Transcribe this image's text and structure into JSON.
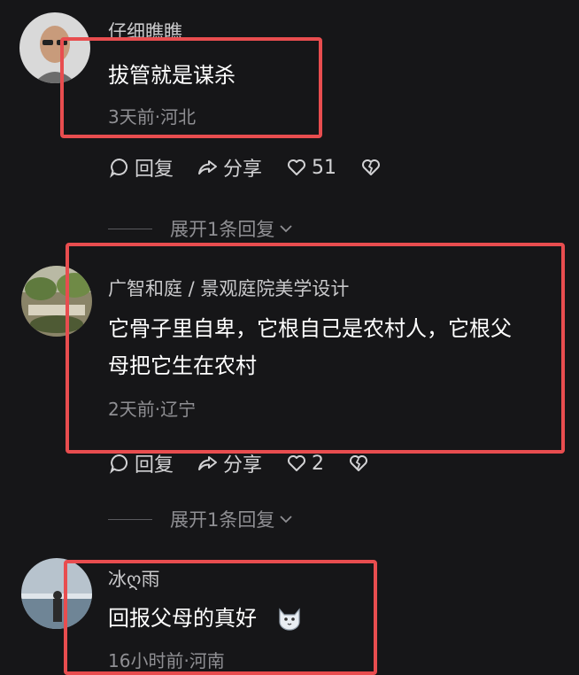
{
  "comments": [
    {
      "username": "仔细瞧瞧",
      "text": "拔管就是谋杀",
      "meta": "3天前·河北",
      "reply_label": "回复",
      "share_label": "分享",
      "likes": "51"
    },
    {
      "username": "广智和庭 / 景观庭院美学设计",
      "text_line1": "它骨子里自卑，它根自己是农村人，它根父",
      "text_line2": "母把它生在农村",
      "meta": "2天前·辽宁",
      "reply_label": "回复",
      "share_label": "分享",
      "likes": "2"
    },
    {
      "username": "冰ღ雨",
      "text": "回报父母的真好",
      "meta": "16小时前·河南"
    }
  ],
  "expand_replies_label": "展开1条回复",
  "colors": {
    "background": "#161618",
    "highlight_box": "#e84d4f",
    "text_primary": "#ffffff",
    "text_secondary": "#8f8f93"
  }
}
